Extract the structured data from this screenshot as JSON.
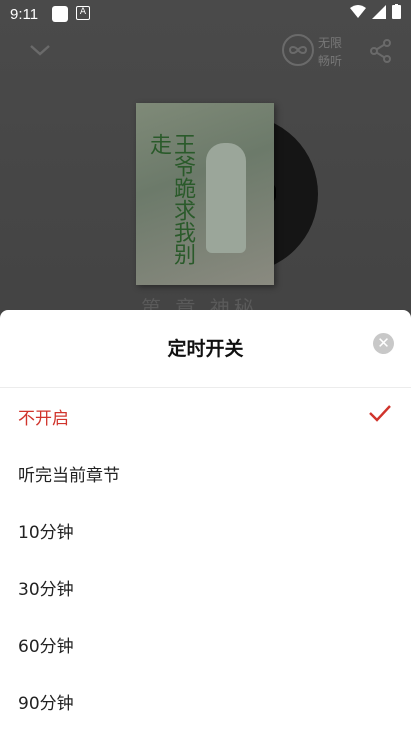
{
  "status_bar": {
    "time": "9:11"
  },
  "player": {
    "infinite_label_line1": "无限",
    "infinite_label_line2": "畅听",
    "cover_title": "王爷跪求我别走",
    "chapter_peek": "第  章 神秘"
  },
  "timer_sheet": {
    "title": "定时开关",
    "selected_index": 0,
    "options": [
      {
        "label": "不开启"
      },
      {
        "label": "听完当前章节"
      },
      {
        "label": "10分钟"
      },
      {
        "label": "30分钟"
      },
      {
        "label": "60分钟"
      },
      {
        "label": "90分钟"
      }
    ]
  },
  "colors": {
    "accent": "#d0342c",
    "overlay": "#3c3c3c"
  }
}
